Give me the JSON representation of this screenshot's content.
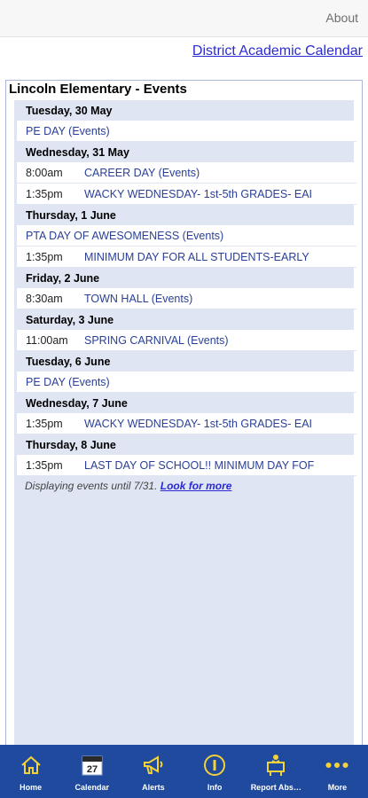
{
  "topbar": {
    "about": "About"
  },
  "district_link": "District Academic Calendar",
  "events": {
    "title": "Lincoln Elementary - Events",
    "days": [
      {
        "header": "Tuesday, 30 May",
        "rows": [
          {
            "time": "",
            "title": "PE DAY (Events)"
          }
        ]
      },
      {
        "header": "Wednesday, 31 May",
        "rows": [
          {
            "time": "8:00am",
            "title": "CAREER DAY (Events)"
          },
          {
            "time": "1:35pm",
            "title": "WACKY WEDNESDAY- 1st-5th GRADES- EAI"
          }
        ]
      },
      {
        "header": "Thursday, 1 June",
        "rows": [
          {
            "time": "",
            "title": "PTA DAY OF AWESOMENESS (Events)"
          },
          {
            "time": "1:35pm",
            "title": "MINIMUM DAY FOR ALL STUDENTS-EARLY"
          }
        ]
      },
      {
        "header": "Friday, 2 June",
        "rows": [
          {
            "time": "8:30am",
            "title": "TOWN HALL (Events)"
          }
        ]
      },
      {
        "header": "Saturday, 3 June",
        "rows": [
          {
            "time": "11:00am",
            "title": "SPRING CARNIVAL (Events)"
          }
        ]
      },
      {
        "header": "Tuesday, 6 June",
        "rows": [
          {
            "time": "",
            "title": "PE DAY (Events)"
          }
        ]
      },
      {
        "header": "Wednesday, 7 June",
        "rows": [
          {
            "time": "1:35pm",
            "title": "WACKY WEDNESDAY- 1st-5th GRADES- EAI"
          }
        ]
      },
      {
        "header": "Thursday, 8 June",
        "rows": [
          {
            "time": "1:35pm",
            "title": "LAST DAY OF SCHOOL!! MINIMUM DAY FOF"
          }
        ]
      }
    ],
    "footer_text": "Displaying events until 7/31. ",
    "footer_link": "Look for more"
  },
  "tabbar": {
    "items": [
      {
        "label": "Home",
        "icon": "home-icon"
      },
      {
        "label": "Calendar",
        "icon": "calendar-icon",
        "calendar_day": "27"
      },
      {
        "label": "Alerts",
        "icon": "megaphone-icon"
      },
      {
        "label": "Info",
        "icon": "info-icon"
      },
      {
        "label": "Report Abs…",
        "icon": "report-absence-icon"
      },
      {
        "label": "More",
        "icon": "more-icon"
      }
    ]
  },
  "colors": {
    "tabbar_bg": "#1f4a9e",
    "icon_yellow": "#f3d23a",
    "link_blue": "#2b2bd2",
    "event_title": "#2a3f96",
    "day_bg": "#dfe5f3"
  }
}
